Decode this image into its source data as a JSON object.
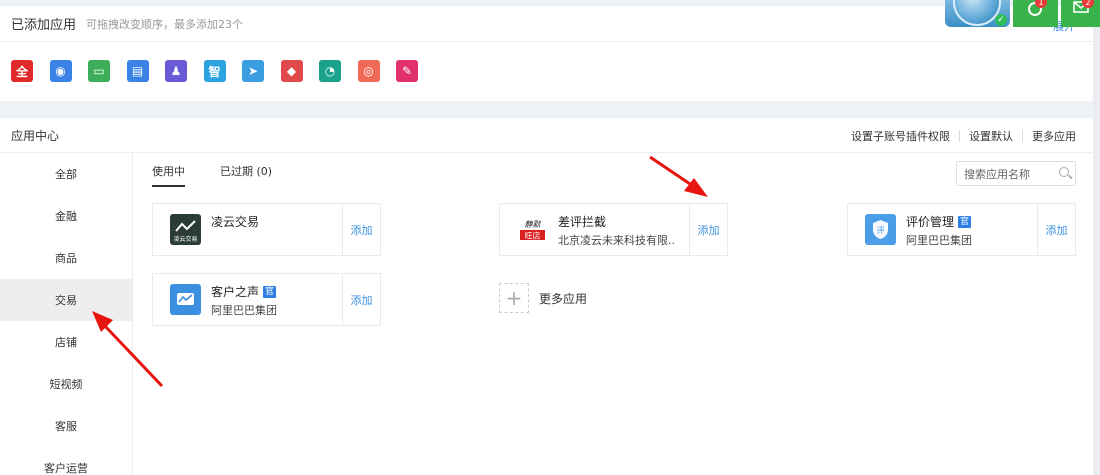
{
  "added": {
    "title": "已添加应用",
    "hint": "可拖拽改变顺序，最多添加23个",
    "collapse": "展开",
    "icons": [
      {
        "name": "quan-app-icon",
        "glyph": "全",
        "color": "#e02a2a"
      },
      {
        "name": "compass-app-icon",
        "glyph": "◉",
        "color": "#3b82e6"
      },
      {
        "name": "window-app-icon",
        "glyph": "▭",
        "color": "#3fae5a"
      },
      {
        "name": "calendar-app-icon",
        "glyph": "▤",
        "color": "#3b82e6"
      },
      {
        "name": "user-app-icon",
        "glyph": "♟",
        "color": "#6a5ad6"
      },
      {
        "name": "zhi-app-icon",
        "glyph": "智",
        "color": "#2aa3e0"
      },
      {
        "name": "send-app-icon",
        "glyph": "➤",
        "color": "#3b9ee0"
      },
      {
        "name": "box-app-icon",
        "glyph": "◆",
        "color": "#e04a4a"
      },
      {
        "name": "gauge-app-icon",
        "glyph": "◔",
        "color": "#1aa38a"
      },
      {
        "name": "coin-app-icon",
        "glyph": "◎",
        "color": "#f06a55"
      },
      {
        "name": "pen-app-icon",
        "glyph": "✎",
        "color": "#e0306e"
      }
    ]
  },
  "overlay": {
    "badge1": "1",
    "badge2": "2"
  },
  "center": {
    "title": "应用中心",
    "links": [
      "设置子账号插件权限",
      "设置默认",
      "更多应用"
    ]
  },
  "sidebar": {
    "items": [
      "全部",
      "金融",
      "商品",
      "交易",
      "店铺",
      "短视频",
      "客服",
      "客户运营"
    ]
  },
  "tabs": [
    "使用中",
    "已过期 (0)"
  ],
  "search": {
    "placeholder": "搜索应用名称"
  },
  "cards": [
    {
      "name": "凌云交易",
      "sub": "",
      "official": false,
      "add": "添加",
      "logo_text": "凌云交易",
      "logo_color": "#2b3b36"
    },
    {
      "name": "差评拦截",
      "sub": "北京凌云未来科技有限...",
      "official": false,
      "add": "添加",
      "logo_text": "静默旺店",
      "logo_color": "#ffffff"
    },
    {
      "name": "评价管理",
      "sub": "阿里巴巴集团",
      "official": true,
      "official_label": "官",
      "add": "添加",
      "logo_text": "评",
      "logo_color": "#4a9ee8"
    },
    {
      "name": "客户之声",
      "sub": "阿里巴巴集团",
      "official": true,
      "official_label": "官",
      "add": "添加",
      "logo_text": "",
      "logo_color": "#3b8fe0"
    }
  ],
  "more_apps": {
    "label": "更多应用"
  },
  "colors": {
    "accent": "#3b8fe0",
    "arrow": "#e8140f",
    "overlay_green": "#3ab34a"
  }
}
